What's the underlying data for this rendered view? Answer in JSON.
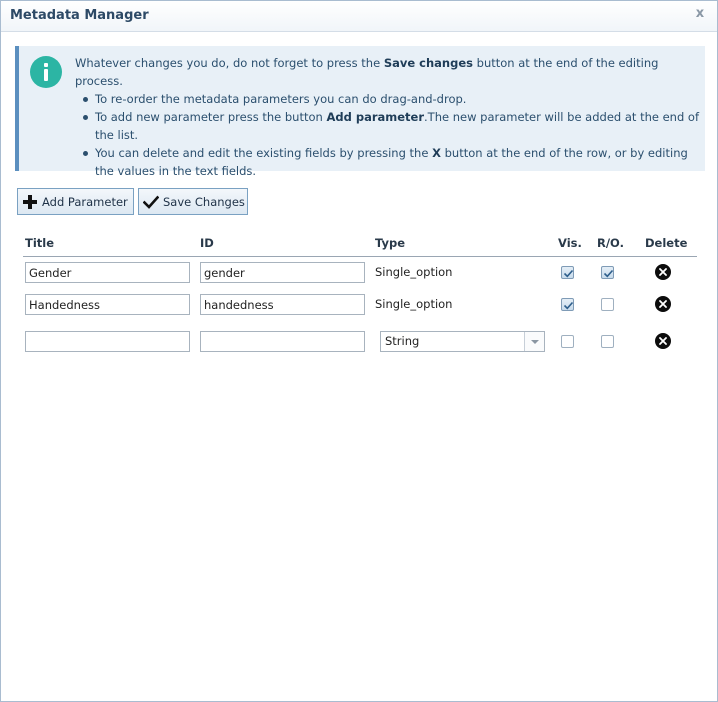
{
  "window": {
    "title": "Metadata Manager",
    "close_label": "x"
  },
  "info": {
    "intro_pre": "Whatever changes you do, do not forget to press the ",
    "intro_bold": "Save changes",
    "intro_post": " button at the end of the editing process.",
    "bullet1": "To re-order the metadata parameters you can do drag-and-drop.",
    "bullet2_pre": "To add new parameter press the button ",
    "bullet2_bold": "Add parameter",
    "bullet2_post": ".The new parameter will be added at the end of the list.",
    "bullet3_pre": "You can delete and edit the existing fields by pressing the ",
    "bullet3_bold": "X",
    "bullet3_post": " button at the end of the row, or by editing the values in the text fields."
  },
  "toolbar": {
    "add_label": "Add Parameter",
    "save_label": "Save Changes"
  },
  "table": {
    "headers": {
      "title": "Title",
      "id": "ID",
      "type": "Type",
      "vis": "Vis.",
      "ro": "R/O.",
      "delete": "Delete"
    },
    "rows": [
      {
        "title": "Gender",
        "id": "gender",
        "type": "Single_option",
        "visible": true,
        "read_only": true
      },
      {
        "title": "Handedness",
        "id": "handedness",
        "type": "Single_option",
        "visible": true,
        "read_only": false
      }
    ],
    "new_row": {
      "title": "",
      "id": "",
      "type": "String",
      "visible": false,
      "read_only": false
    }
  },
  "icons": {
    "info": "info-icon",
    "add": "plus-icon",
    "save": "checkmark-icon",
    "delete": "delete-x-icon",
    "dropdown": "chevron-down-icon"
  },
  "colors": {
    "info_background": "#e8f0f7",
    "info_accent": "#2cb5a4",
    "title_text": "#2d4a66"
  }
}
